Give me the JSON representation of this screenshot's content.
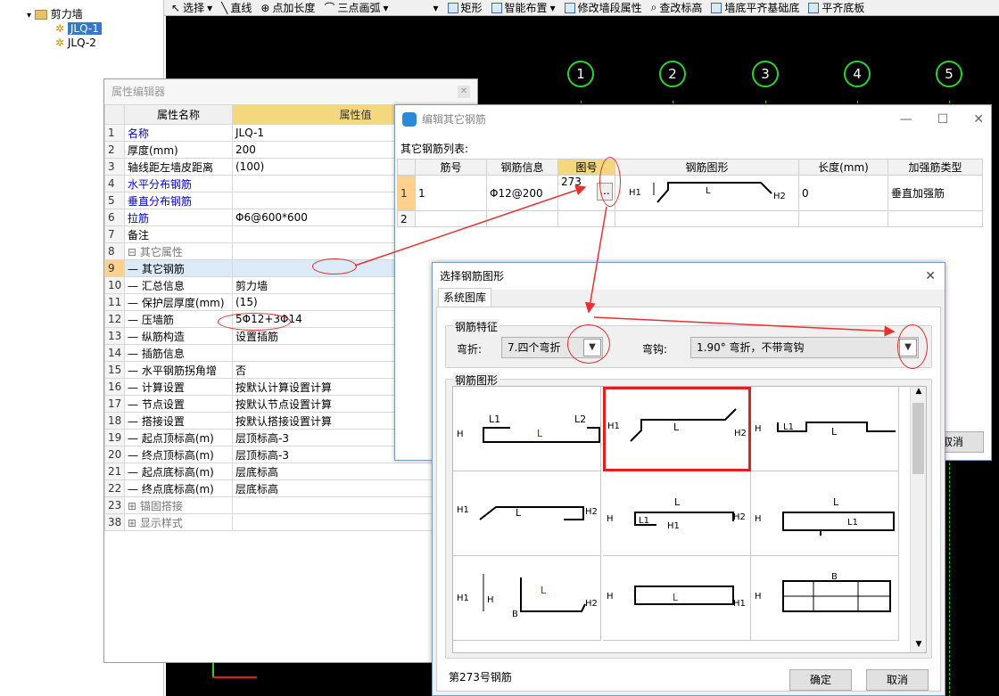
{
  "tree": {
    "root": "剪力墙",
    "items": [
      "JLQ-1",
      "JLQ-2"
    ]
  },
  "toolbar": {
    "items": [
      "选择",
      "直线",
      "点加长度",
      "三点画弧",
      "矩形",
      "智能布置",
      "修改墙段属性",
      "查改标高",
      "墙底平齐基础底",
      "平齐底板"
    ]
  },
  "cad": {
    "axes": [
      "1",
      "2",
      "3",
      "4",
      "5"
    ],
    "line_color": "#2fd12f"
  },
  "prop_editor": {
    "title": "属性编辑器",
    "col_name": "属性名称",
    "col_value": "属性值",
    "rows": [
      {
        "num": "1",
        "name": "名称",
        "value": "JLQ-1",
        "style": "blue"
      },
      {
        "num": "2",
        "name": "厚度(mm)",
        "value": "200",
        "style": "normal"
      },
      {
        "num": "3",
        "name": "轴线距左墙皮距离",
        "value": "(100)",
        "style": "normal"
      },
      {
        "num": "4",
        "name": "水平分布钢筋",
        "value": "",
        "style": "blue"
      },
      {
        "num": "5",
        "name": "垂直分布钢筋",
        "value": "",
        "style": "blue"
      },
      {
        "num": "6",
        "name": "拉筋",
        "value": "Φ6@600*600",
        "style": "blue"
      },
      {
        "num": "7",
        "name": "备注",
        "value": "",
        "style": "normal"
      },
      {
        "num": "8",
        "name": "⊟ 其它属性",
        "value": "",
        "style": "grey"
      },
      {
        "num": "9",
        "name": "— 其它钢筋",
        "value": "",
        "style": "sel"
      },
      {
        "num": "10",
        "name": "— 汇总信息",
        "value": "剪力墙",
        "style": "normal"
      },
      {
        "num": "11",
        "name": "— 保护层厚度(mm)",
        "value": "(15)",
        "style": "normal"
      },
      {
        "num": "12",
        "name": "— 压墙筋",
        "value": "5Φ12+3Φ14",
        "style": "normal"
      },
      {
        "num": "13",
        "name": "— 纵筋构造",
        "value": "设置插筋",
        "style": "normal"
      },
      {
        "num": "14",
        "name": "— 插筋信息",
        "value": "",
        "style": "normal"
      },
      {
        "num": "15",
        "name": "— 水平钢筋拐角增",
        "value": "否",
        "style": "normal"
      },
      {
        "num": "16",
        "name": "— 计算设置",
        "value": "按默认计算设置计算",
        "style": "normal"
      },
      {
        "num": "17",
        "name": "— 节点设置",
        "value": "按默认节点设置计算",
        "style": "normal"
      },
      {
        "num": "18",
        "name": "— 搭接设置",
        "value": "按默认搭接设置计算",
        "style": "normal"
      },
      {
        "num": "19",
        "name": "— 起点顶标高(m)",
        "value": "层顶标高-3",
        "style": "normal"
      },
      {
        "num": "20",
        "name": "— 终点顶标高(m)",
        "value": "层顶标高-3",
        "style": "normal"
      },
      {
        "num": "21",
        "name": "— 起点底标高(m)",
        "value": "层底标高",
        "style": "normal"
      },
      {
        "num": "22",
        "name": "— 终点底标高(m)",
        "value": "层底标高",
        "style": "normal"
      },
      {
        "num": "23",
        "name": "⊞ 锚固搭接",
        "value": "",
        "style": "grey"
      },
      {
        "num": "38",
        "name": "⊞ 显示样式",
        "value": "",
        "style": "grey"
      }
    ]
  },
  "edit_rebar": {
    "title": "编辑其它钢筋",
    "list_label": "其它钢筋列表:",
    "headers": [
      "筋号",
      "钢筋信息",
      "图号",
      "钢筋图形",
      "长度(mm)",
      "加强筋类型"
    ],
    "rows": [
      {
        "num": "1",
        "bar_no": "1",
        "info": "Φ12@200",
        "shape_no": "273",
        "length": "0",
        "type": "垂直加强筋"
      },
      {
        "num": "2",
        "bar_no": "",
        "info": "",
        "shape_no": "",
        "length": "",
        "type": ""
      }
    ],
    "cancel_label": "取消",
    "ellipsis": "..."
  },
  "choose_shape": {
    "title": "选择钢筋图形",
    "tab": "系统图库",
    "features_label": "钢筋特征",
    "bend_label": "弯折:",
    "bend_value": "7.四个弯折",
    "hook_label": "弯钩:",
    "hook_value": "1.90° 弯折，不带弯钩",
    "shapes_label": "钢筋图形",
    "status": "第273号钢筋",
    "ok_label": "确定",
    "cancel_label": "取消"
  }
}
